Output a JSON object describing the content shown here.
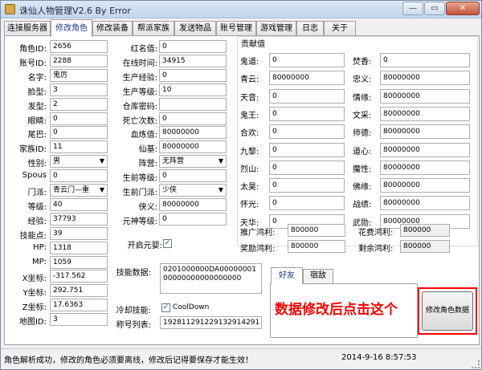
{
  "window": {
    "title": "诛仙人物管理V2.6 By Error",
    "min_glyph": "—",
    "max_glyph": "▭",
    "close_glyph": "✕"
  },
  "tabs": [
    "连接服务器",
    "修改角色",
    "修改装备",
    "帮派家族",
    "发送物品",
    "账号管理",
    "游戏管理",
    "日志",
    "关于"
  ],
  "col1": [
    {
      "label": "角色ID:",
      "value": "2656"
    },
    {
      "label": "账号ID:",
      "value": "2288"
    },
    {
      "label": "名字:",
      "value": "鬼厉"
    },
    {
      "label": "脸型:",
      "value": "3"
    },
    {
      "label": "发型:",
      "value": "2"
    },
    {
      "label": "眼睛:",
      "value": "0"
    },
    {
      "label": "尾巴:",
      "value": "0"
    },
    {
      "label": "家族ID:",
      "value": "11"
    },
    {
      "label": "性别:",
      "value": "男",
      "select": true
    },
    {
      "label": "Spous",
      "value": "0"
    },
    {
      "label": "门派:",
      "value": "青云门—重",
      "select": true
    },
    {
      "label": "等级:",
      "value": "40"
    },
    {
      "label": "经验:",
      "value": "37793"
    },
    {
      "label": "技能点:",
      "value": "39"
    },
    {
      "label": "HP:",
      "value": "1318"
    },
    {
      "label": "MP:",
      "value": "1059"
    },
    {
      "label": "X坐标:",
      "value": "-317.562"
    },
    {
      "label": "Y坐标:",
      "value": "292.751"
    },
    {
      "label": "Z坐标:",
      "value": "17.6363"
    },
    {
      "label": "地图ID:",
      "value": "3"
    }
  ],
  "col2": [
    {
      "label": "红名值:",
      "value": "0"
    },
    {
      "label": "在线时间:",
      "value": "34915"
    },
    {
      "label": "生产经验:",
      "value": "0"
    },
    {
      "label": "生产等级:",
      "value": "10"
    },
    {
      "label": "仓库密码:",
      "value": ""
    },
    {
      "label": "死亡次数:",
      "value": "0"
    },
    {
      "label": "血炼值:",
      "value": "80000000"
    },
    {
      "label": "仙基:",
      "value": "80000000"
    },
    {
      "label": "阵营:",
      "value": "无阵营",
      "select": true
    },
    {
      "label": "生前等级:",
      "value": "0"
    },
    {
      "label": "生前门派:",
      "value": "少侠",
      "select": true
    },
    {
      "label": "侠义:",
      "value": "80000000"
    },
    {
      "label": "元神等级:",
      "value": "0"
    }
  ],
  "open_yuanshen": {
    "label": "开启元婴:",
    "checked": true
  },
  "skill_data": {
    "label": "技能数据:",
    "value": "0201000000DA0000000100000000000000000"
  },
  "cool_skill": {
    "label": "冷却技能:",
    "checkbox_label": "CoolDown",
    "checked": true
  },
  "title_list": {
    "label": "称号列表:",
    "value": "192811291229132914291 5"
  },
  "contribution": {
    "title": "贡献值",
    "rows": [
      [
        {
          "label": "鬼道:",
          "value": "0"
        },
        {
          "label": "焚香:",
          "value": "0"
        }
      ],
      [
        {
          "label": "青云:",
          "value": "80000000"
        },
        {
          "label": "忠义:",
          "value": "80000000"
        }
      ],
      [
        {
          "label": "天音:",
          "value": "0"
        },
        {
          "label": "情缘:",
          "value": "80000000"
        }
      ],
      [
        {
          "label": "鬼王:",
          "value": "0"
        },
        {
          "label": "文采:",
          "value": "80000000"
        }
      ],
      [
        {
          "label": "合欢:",
          "value": "0"
        },
        {
          "label": "师德:",
          "value": "80000000"
        }
      ],
      [
        {
          "label": "九黎:",
          "value": "0"
        },
        {
          "label": "道心:",
          "value": "80000000"
        }
      ],
      [
        {
          "label": "烈山:",
          "value": "0"
        },
        {
          "label": "魔性:",
          "value": "80000000"
        }
      ],
      [
        {
          "label": "太昊:",
          "value": "0"
        },
        {
          "label": "佛缘:",
          "value": "80000000"
        }
      ],
      [
        {
          "label": "怀光:",
          "value": "0"
        },
        {
          "label": "战绩:",
          "value": "80000000"
        }
      ],
      [
        {
          "label": "天华:",
          "value": "0"
        },
        {
          "label": "武勋:",
          "value": "80000000"
        }
      ]
    ],
    "bonus_rows": [
      [
        {
          "label": "推广鸿利:",
          "value": "800000"
        },
        {
          "label": "花费鸿利:",
          "value": "800000"
        }
      ],
      [
        {
          "label": "奖励鸿利:",
          "value": "800000"
        },
        {
          "label": "剩余鸿利:",
          "value": "800000"
        }
      ]
    ]
  },
  "subtabs": [
    "好友",
    "宿敌"
  ],
  "annotation": "数据修改后点击这个",
  "save_button": "修改角色数据",
  "status": {
    "message": "角色解析成功，修改的角色必须要离线，修改后记得要保存才能生效！",
    "time": "2014-9-16  8:57:53"
  },
  "colors": {
    "accent": "#1a3c8c",
    "annotation": "#ff0000"
  }
}
